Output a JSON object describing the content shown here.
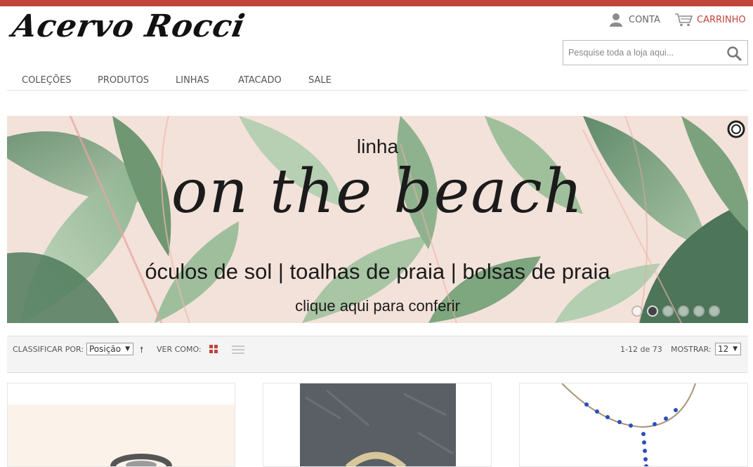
{
  "brand": {
    "logo_text": "Acervo Rocci",
    "accent": "#c1443b"
  },
  "header": {
    "account_label": "CONTA",
    "cart_label": "CARRINHO",
    "search_placeholder": "Pesquise toda a loja aqui..."
  },
  "nav": {
    "items": [
      "COLEÇÕES",
      "PRODUTOS",
      "LINHAS",
      "ATACADO",
      "SALE"
    ]
  },
  "banner": {
    "line1": "linha",
    "line2": "on the beach",
    "line3": "óculos de sol | toalhas de praia | bolsas de praia",
    "line4": "clique aqui para conferir",
    "slide_count": 6,
    "active_slide": 2
  },
  "toolbar": {
    "sort_label": "CLASSIFICAR POR:",
    "sort_value": "Posição",
    "view_label": "VER COMO:",
    "range_text": "1-12 de 73",
    "show_label": "MOSTRAR:",
    "show_value": "12"
  },
  "icons": [
    "user-icon",
    "cart-icon",
    "search-icon",
    "pause-icon",
    "grid-view-icon",
    "list-view-icon",
    "sort-direction-icon"
  ]
}
